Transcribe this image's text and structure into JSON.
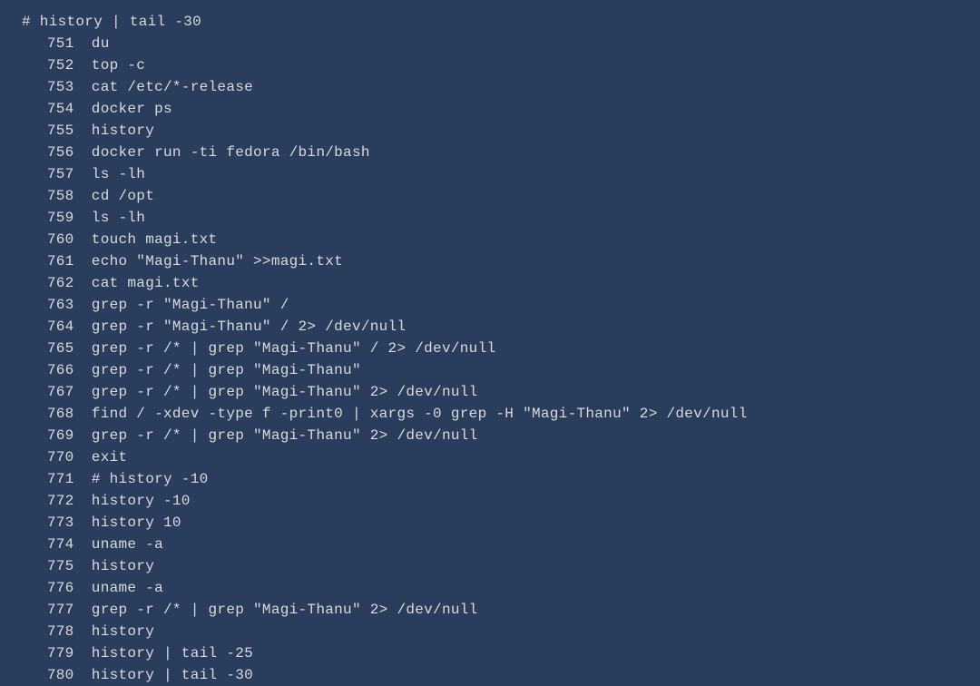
{
  "prompt": "# history | tail -30",
  "history": [
    {
      "num": "751",
      "cmd": "du"
    },
    {
      "num": "752",
      "cmd": "top -c"
    },
    {
      "num": "753",
      "cmd": "cat /etc/*-release"
    },
    {
      "num": "754",
      "cmd": "docker ps"
    },
    {
      "num": "755",
      "cmd": "history"
    },
    {
      "num": "756",
      "cmd": "docker run -ti fedora /bin/bash"
    },
    {
      "num": "757",
      "cmd": "ls -lh"
    },
    {
      "num": "758",
      "cmd": "cd /opt"
    },
    {
      "num": "759",
      "cmd": "ls -lh"
    },
    {
      "num": "760",
      "cmd": "touch magi.txt"
    },
    {
      "num": "761",
      "cmd": "echo \"Magi-Thanu\" >>magi.txt"
    },
    {
      "num": "762",
      "cmd": "cat magi.txt"
    },
    {
      "num": "763",
      "cmd": "grep -r \"Magi-Thanu\" /"
    },
    {
      "num": "764",
      "cmd": "grep -r \"Magi-Thanu\" / 2> /dev/null"
    },
    {
      "num": "765",
      "cmd": "grep -r /* | grep \"Magi-Thanu\" / 2> /dev/null"
    },
    {
      "num": "766",
      "cmd": "grep -r /* | grep \"Magi-Thanu\""
    },
    {
      "num": "767",
      "cmd": "grep -r /* | grep \"Magi-Thanu\" 2> /dev/null"
    },
    {
      "num": "768",
      "cmd": "find / -xdev -type f -print0 | xargs -0 grep -H \"Magi-Thanu\" 2> /dev/null"
    },
    {
      "num": "769",
      "cmd": "grep -r /* | grep \"Magi-Thanu\" 2> /dev/null"
    },
    {
      "num": "770",
      "cmd": "exit"
    },
    {
      "num": "771",
      "cmd": "# history -10"
    },
    {
      "num": "772",
      "cmd": "history -10"
    },
    {
      "num": "773",
      "cmd": "history 10"
    },
    {
      "num": "774",
      "cmd": "uname -a"
    },
    {
      "num": "775",
      "cmd": "history"
    },
    {
      "num": "776",
      "cmd": "uname -a"
    },
    {
      "num": "777",
      "cmd": "grep -r /* | grep \"Magi-Thanu\" 2> /dev/null"
    },
    {
      "num": "778",
      "cmd": "history"
    },
    {
      "num": "779",
      "cmd": "history | tail -25"
    },
    {
      "num": "780",
      "cmd": "history | tail -30"
    }
  ]
}
